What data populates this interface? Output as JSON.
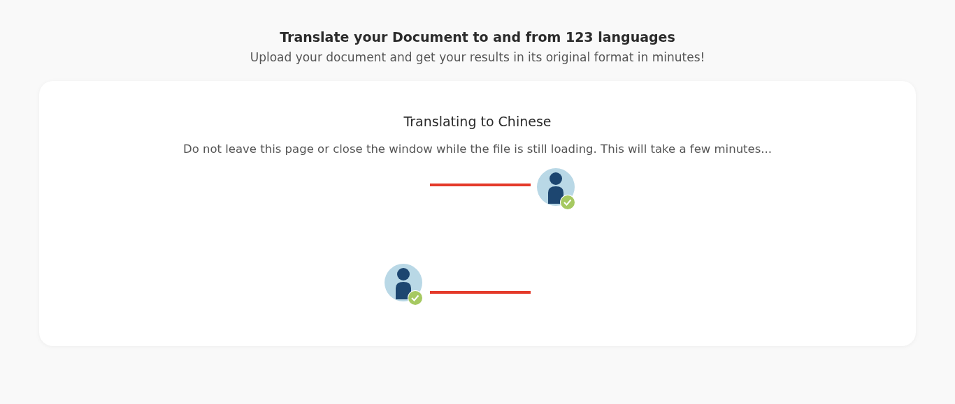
{
  "header": {
    "title": "Translate your Document to and from 123 languages",
    "subtitle": "Upload your document and get your results in its original format in minutes!"
  },
  "card": {
    "title": "Translating to Chinese",
    "message": "Do not leave this page or close the window while the file is still loading. This will take a few minutes..."
  }
}
